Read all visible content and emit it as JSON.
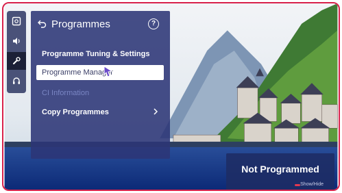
{
  "panel": {
    "title": "Programmes",
    "menu": [
      {
        "label": "Programme Tuning & Settings",
        "state": "normal"
      },
      {
        "label": "Programme Manager",
        "state": "selected"
      },
      {
        "label": "CI Information",
        "state": "disabled"
      },
      {
        "label": "Copy Programmes",
        "state": "submenu"
      }
    ]
  },
  "status": {
    "title": "Not Programmed",
    "hint": "Show/Hide"
  },
  "icon_rail": [
    "picture-icon",
    "sound-icon",
    "programmes-icon",
    "support-icon"
  ],
  "colors": {
    "panel": "#2c3676",
    "selection": "#ffffff",
    "selected_text": "#3a3e66",
    "disabled_text": "#7a86c4",
    "frame_border": "#d8214a",
    "hint_key": "#e23850"
  }
}
